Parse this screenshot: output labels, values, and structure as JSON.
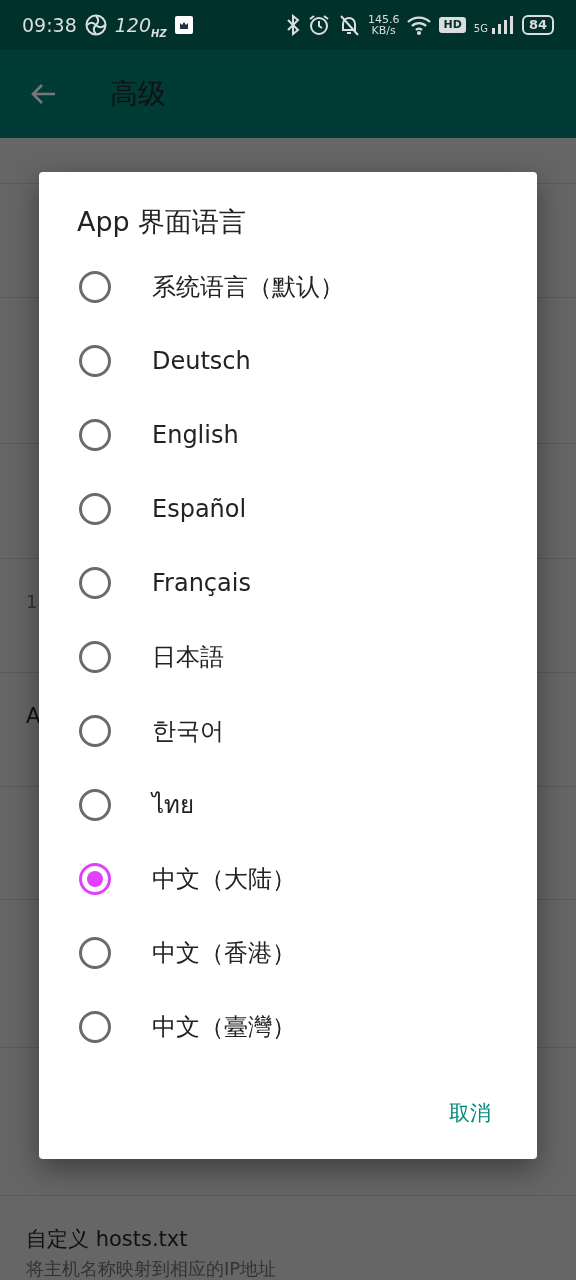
{
  "status_bar": {
    "time": "09:38",
    "refresh_rate": "120",
    "refresh_unit": "HZ",
    "net_speed": "145.6",
    "net_unit": "KB/s",
    "hd": "HD",
    "network": "5G",
    "battery": "84"
  },
  "toolbar": {
    "title": "高级"
  },
  "settings": [
    {
      "summary": [
        "1"
      ]
    },
    {
      "title": "A"
    },
    {
      "title": "自定义 hosts.txt",
      "summary": [
        "将主机名称映射到相应的IP地址"
      ]
    }
  ],
  "dialog": {
    "title": "App 界面语言",
    "options": [
      {
        "label": "系统语言（默认）",
        "selected": false
      },
      {
        "label": "Deutsch",
        "selected": false
      },
      {
        "label": "English",
        "selected": false
      },
      {
        "label": "Español",
        "selected": false
      },
      {
        "label": "Français",
        "selected": false
      },
      {
        "label": "日本語",
        "selected": false
      },
      {
        "label": "한국어",
        "selected": false
      },
      {
        "label": "ไทย",
        "selected": false
      },
      {
        "label": "中文（大陆）",
        "selected": true
      },
      {
        "label": "中文（香港）",
        "selected": false
      },
      {
        "label": "中文（臺灣）",
        "selected": false
      }
    ],
    "buttons": [
      "取消"
    ]
  }
}
